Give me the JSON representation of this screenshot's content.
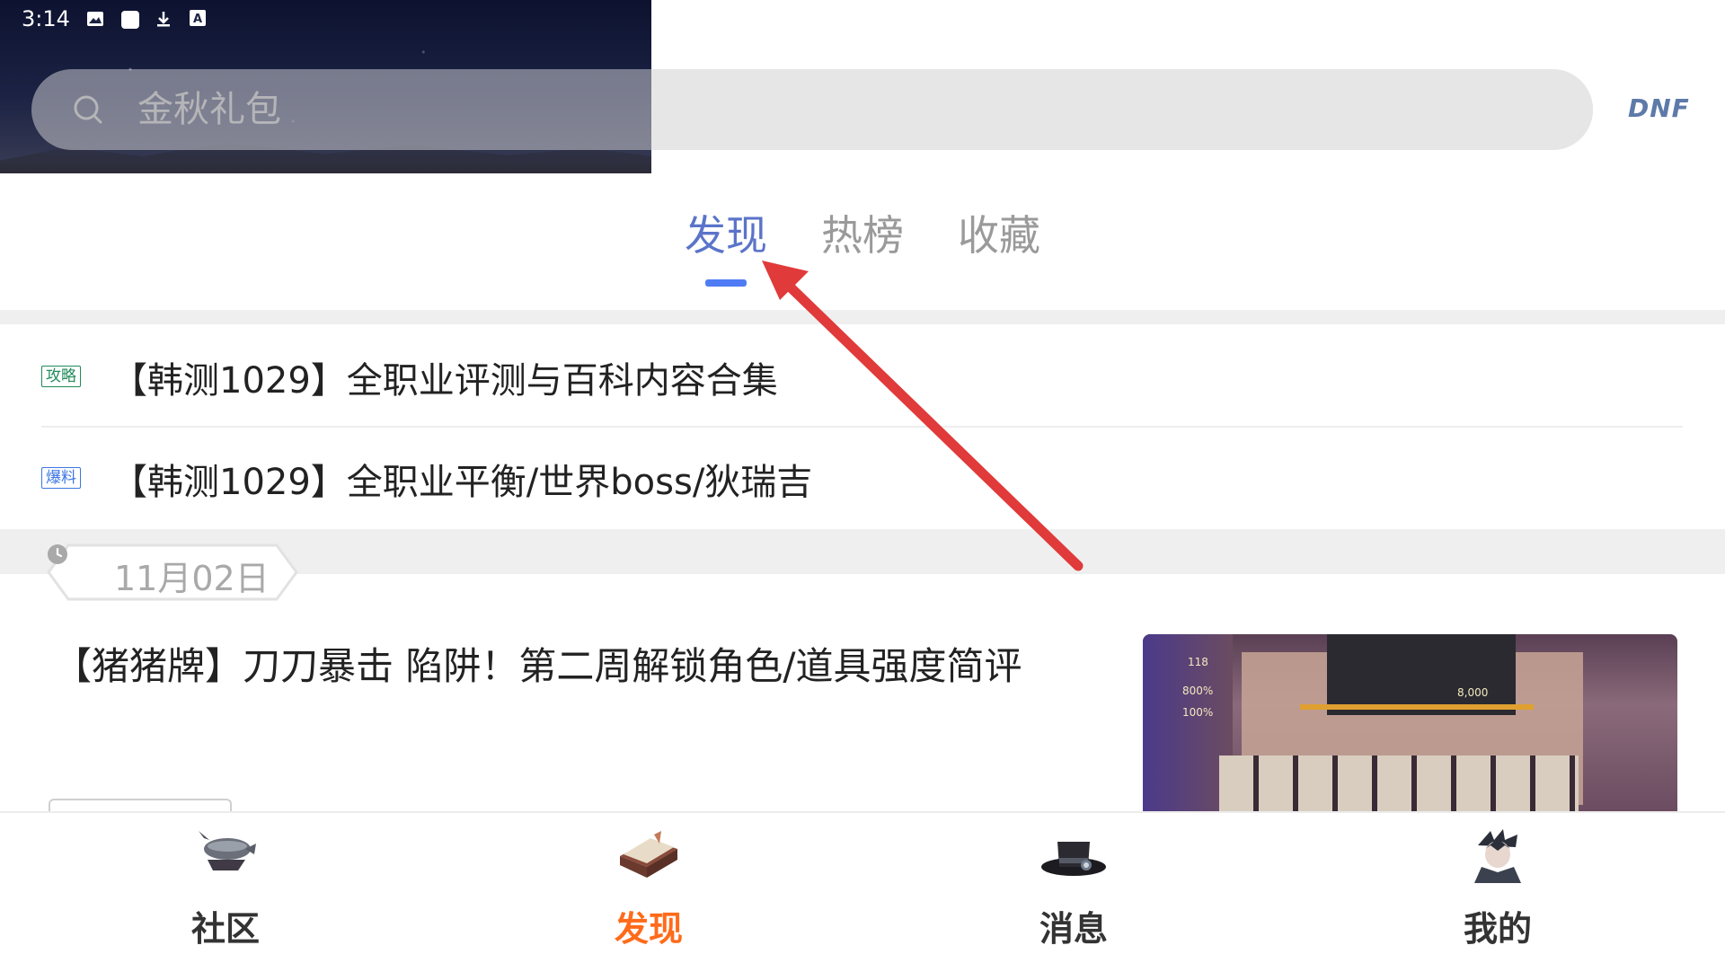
{
  "status_bar": {
    "time": "3:14",
    "icons": [
      "image-icon",
      "square-icon",
      "download-icon",
      "a-icon"
    ]
  },
  "search": {
    "placeholder": "金秋礼包"
  },
  "game_tag": "DNF",
  "tabs": [
    {
      "label": "发现",
      "active": true
    },
    {
      "label": "热榜",
      "active": false
    },
    {
      "label": "收藏",
      "active": false
    }
  ],
  "news": [
    {
      "badge": "攻略",
      "badge_color": "#1f8a5a",
      "title": "【韩测1029】全职业评测与百科内容合集"
    },
    {
      "badge": "爆料",
      "badge_color": "#3b76e0",
      "title": "【韩测1029】全职业平衡/世界boss/狄瑞吉"
    }
  ],
  "feed": {
    "date": "11月02日",
    "article_title": "【猪猪牌】刀刀暴击 陷阱！第二周解锁角色/道具强度简评",
    "thumbnail_text": {
      "hp_value": "8,000",
      "side_value_1": "118",
      "side_value_2": "800%",
      "side_value_3": "100%"
    }
  },
  "bottom_nav": [
    {
      "label": "社区",
      "icon": "airship-icon",
      "active": false
    },
    {
      "label": "发现",
      "icon": "book-icon",
      "active": true
    },
    {
      "label": "消息",
      "icon": "top-hat-icon",
      "active": false
    },
    {
      "label": "我的",
      "icon": "avatar-icon",
      "active": false
    }
  ],
  "colors": {
    "accent_tab": "#5b74c9",
    "indicator": "#4f7cf5",
    "nav_active": "#ff6b1a",
    "annotation_arrow": "#e03a3a"
  }
}
